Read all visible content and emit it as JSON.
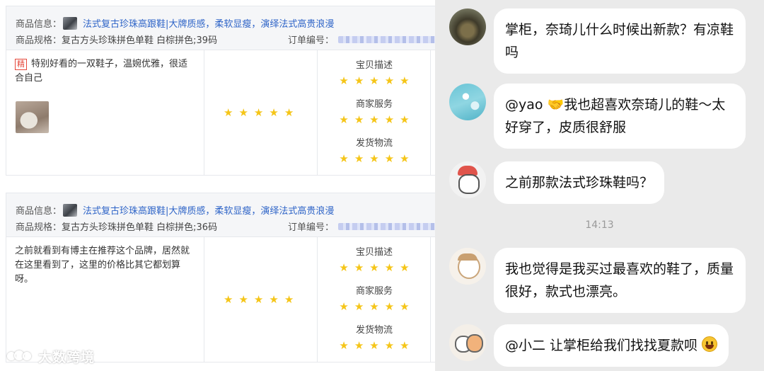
{
  "reviews": [
    {
      "product_info_label": "商品信息：",
      "product_title": "法式复古珍珠高跟鞋|大牌质感，柔软显瘦，演绎法式高贵浪漫",
      "spec_label": "商品规格：",
      "spec_value": "复古方头珍珠拼色单鞋 白棕拼色;39码",
      "order_label": "订单编号：",
      "tag": "精",
      "text": "特别好看的一双鞋子，温婉优雅，很适合自己",
      "ratings": [
        {
          "label": "宝贝描述",
          "stars": 5
        },
        {
          "label": "商家服务",
          "stars": 5
        },
        {
          "label": "发货物流",
          "stars": 5
        }
      ],
      "overall_stars": 5
    },
    {
      "product_info_label": "商品信息：",
      "product_title": "法式复古珍珠高跟鞋|大牌质感，柔软显瘦，演绎法式高贵浪漫",
      "spec_label": "商品规格：",
      "spec_value": "复古方头珍珠拼色单鞋 白棕拼色;36码",
      "order_label": "订单编号：",
      "text": "之前就看到有博主在推荐这个品牌，居然就在这里看到了，这里的价格比其它都划算呀。",
      "ratings": [
        {
          "label": "宝贝描述",
          "stars": 5
        },
        {
          "label": "商家服务",
          "stars": 5
        },
        {
          "label": "发货物流",
          "stars": 5
        }
      ],
      "overall_stars": 5
    }
  ],
  "star_glyph": "★",
  "star_color": "#f5c518",
  "chat": {
    "messages": [
      {
        "text": "掌柜，奈琦儿什么时候出新款？有凉鞋吗"
      },
      {
        "prefix": "@yao ",
        "emoji": "🤝",
        "text": "我也超喜欢奈琦儿的鞋～太好穿了，皮质很舒服"
      },
      {
        "text": "之前那款法式珍珠鞋吗？"
      },
      {
        "text": "我也觉得是我买过最喜欢的鞋了，质量很好，款式也漂亮。"
      },
      {
        "text": "@小二 让掌柜给我们找找夏款呗",
        "emoji_icon": "smile-emoji"
      }
    ],
    "timestamp": "14:13"
  },
  "watermark": "大数跨境"
}
